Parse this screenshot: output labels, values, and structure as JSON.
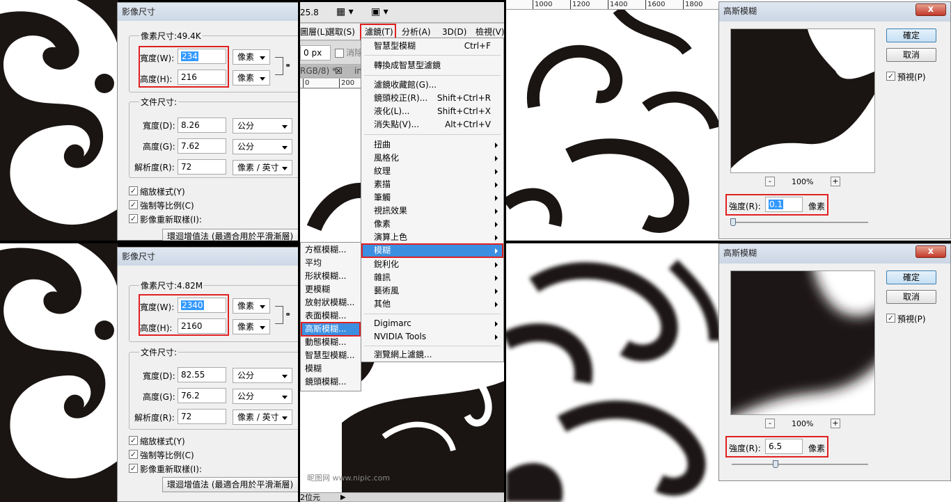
{
  "image_size_dialog": {
    "title": "影像尺寸",
    "doc_size_title": "文件尺寸:",
    "width_label": "寬度(W):",
    "height_label": "高度(H):",
    "doc_width_label": "寬度(D):",
    "doc_height_label": "高度(G):",
    "resolution_label": "解析度(R):",
    "unit_pixels": "像素",
    "unit_cm": "公分",
    "unit_ppi": "像素 / 英寸",
    "scale_styles": "縮放樣式(Y)",
    "constrain": "強制等比例(C)",
    "resample": "影像重新取樣(I):",
    "resample_method": "環迴增值法 (最適合用於平滑漸層)",
    "top": {
      "pixel_dims": "像素尺寸:49.4K",
      "width": "234",
      "height": "216",
      "doc_width": "8.26",
      "doc_height": "7.62",
      "resolution": "72"
    },
    "bottom": {
      "pixel_dims": "像素尺寸:4.82M",
      "width": "2340",
      "height": "2160",
      "doc_width": "82.55",
      "doc_height": "76.2",
      "resolution": "72"
    }
  },
  "photoshop": {
    "zoom_readout": "25.8",
    "menubar": [
      "圖層(L)",
      "選取(S)",
      "濾鏡(T)",
      "分析(A)",
      "3D(D)",
      "檢視(V)"
    ],
    "options_value": "0 px",
    "options_checkbox": "消除",
    "tab_label": "RGB/8) *",
    "tab_label2": "in",
    "ruler_marks": [
      "0",
      "200"
    ],
    "status_text": "2位元",
    "filter_menu": [
      {
        "label": "智慧型模糊",
        "shortcut": "Ctrl+F"
      },
      {
        "label": "轉換成智慧型濾鏡",
        "shortcut": ""
      },
      {
        "label": "濾鏡收藏館(G)...",
        "shortcut": ""
      },
      {
        "label": "鏡頭校正(R)...",
        "shortcut": "Shift+Ctrl+R"
      },
      {
        "label": "液化(L)...",
        "shortcut": "Shift+Ctrl+X"
      },
      {
        "label": "消失點(V)...",
        "shortcut": "Alt+Ctrl+V"
      },
      {
        "label": "扭曲"
      },
      {
        "label": "風格化"
      },
      {
        "label": "紋理"
      },
      {
        "label": "素描"
      },
      {
        "label": "筆觸"
      },
      {
        "label": "視訊效果"
      },
      {
        "label": "像素"
      },
      {
        "label": "演算上色"
      },
      {
        "label": "模糊"
      },
      {
        "label": "銳利化"
      },
      {
        "label": "雜訊"
      },
      {
        "label": "藝術風"
      },
      {
        "label": "其他"
      },
      {
        "label": "Digimarc"
      },
      {
        "label": "NVIDIA Tools"
      },
      {
        "label": "瀏覽網上濾鏡..."
      }
    ],
    "blur_submenu": [
      "方框模糊...",
      "平均",
      "形狀模糊...",
      "更模糊",
      "放射狀模糊...",
      "表面模糊...",
      "高斯模糊...",
      "動態模糊...",
      "智慧型模糊...",
      "模糊",
      "鏡頭模糊..."
    ]
  },
  "gaussian_dialog": {
    "title": "高斯模糊",
    "ok": "確定",
    "cancel": "取消",
    "preview": "預視(P)",
    "zoom": "100%",
    "radius_label": "強度(R):",
    "unit": "像素",
    "top_radius": "0.1",
    "bottom_radius": "6.5",
    "minus": "-",
    "plus": "+",
    "close": "x",
    "top_slider_fraction": 0.0,
    "bottom_slider_fraction": 0.31
  },
  "canvas_ruler": [
    "1000",
    "1200",
    "1400",
    "1600",
    "1800"
  ],
  "watermark": "昵图网 www.nipic.com"
}
